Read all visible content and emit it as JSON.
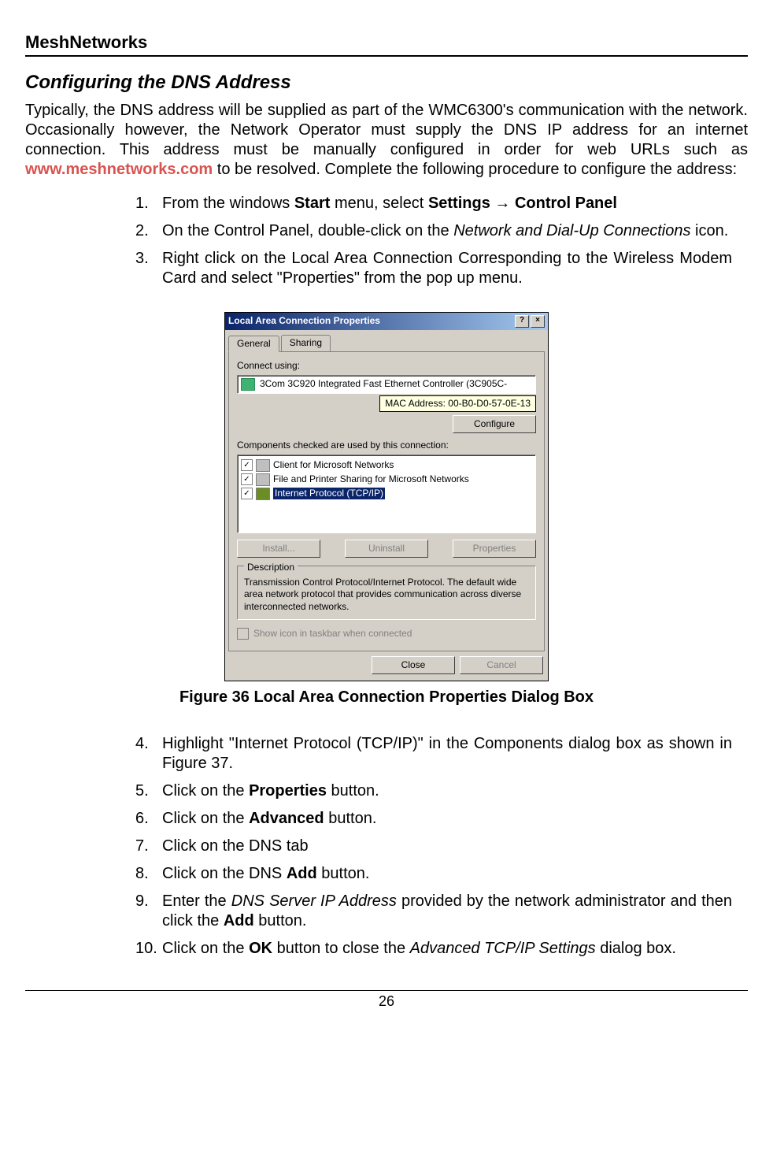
{
  "header": {
    "title": "MeshNetworks"
  },
  "section": {
    "title": "Configuring the DNS Address"
  },
  "intro": {
    "part1": "Typically, the DNS address will be supplied as part of the WMC6300's communication with the network. Occasionally however, the Network Operator must supply the DNS IP address for an internet connection.  This address must be manually configured in order for web URLs such as ",
    "link": "www.meshnetworks.com",
    "part2": " to be resolved.  Complete the following procedure to configure the address:"
  },
  "steps": {
    "s1": {
      "num": "1.",
      "pre": "From the windows ",
      "b1": "Start",
      "mid": " menu, select ",
      "b2": "Settings → Control Panel"
    },
    "s2": {
      "num": "2.",
      "pre": "On  the  Control  Panel,  double-click  on  the  ",
      "i1": "Network  and  Dial-Up Connections",
      "post": " icon."
    },
    "s3": {
      "num": "3.",
      "text": "Right click on the Local Area Connection Corresponding to the Wireless Modem Card and select \"Properties\" from the pop up menu."
    },
    "s4": {
      "num": "4.",
      "text": "Highlight \"Internet Protocol (TCP/IP)\" in the Components dialog box as shown in Figure 37."
    },
    "s5": {
      "num": "5.",
      "pre": "Click on the ",
      "b1": "Properties",
      "post": " button."
    },
    "s6": {
      "num": "6.",
      "pre": "Click on the ",
      "b1": "Advanced",
      "post": " button."
    },
    "s7": {
      "num": "7.",
      "text": "Click on the DNS tab"
    },
    "s8": {
      "num": "8.",
      "pre": "Click on the DNS ",
      "b1": "Add",
      "post": " button."
    },
    "s9": {
      "num": "9.",
      "pre": "Enter the ",
      "i1": "DNS Server IP Address",
      "mid": " provided by the network administrator and then click the ",
      "b1": "Add",
      "post": " button."
    },
    "s10": {
      "num": "10.",
      "pre": "Click on the ",
      "b1": "OK",
      "mid": " button to close the ",
      "i1": "Advanced TCP/IP Settings",
      "post": " dialog box."
    }
  },
  "dialog": {
    "title": "Local Area Connection Properties",
    "tabs": {
      "general": "General",
      "sharing": "Sharing"
    },
    "connect_using": "Connect using:",
    "adapter": "3Com 3C920 Integrated Fast Ethernet Controller (3C905C-",
    "mac_tooltip": "MAC Address: 00-B0-D0-57-0E-13",
    "configure": "Configure",
    "components_label": "Components checked are used by this connection:",
    "components": {
      "c1": "Client for Microsoft Networks",
      "c2": "File and Printer Sharing for Microsoft Networks",
      "c3": "Internet Protocol (TCP/IP)"
    },
    "install": "Install...",
    "uninstall": "Uninstall",
    "properties": "Properties",
    "description_label": "Description",
    "description_text": "Transmission Control Protocol/Internet Protocol. The default wide area network protocol that provides communication across diverse interconnected networks.",
    "show_icon": "Show icon in taskbar when connected",
    "close": "Close",
    "cancel": "Cancel"
  },
  "figure": {
    "caption": "Figure 36       Local Area Connection Properties Dialog Box"
  },
  "footer": {
    "page": "26"
  }
}
